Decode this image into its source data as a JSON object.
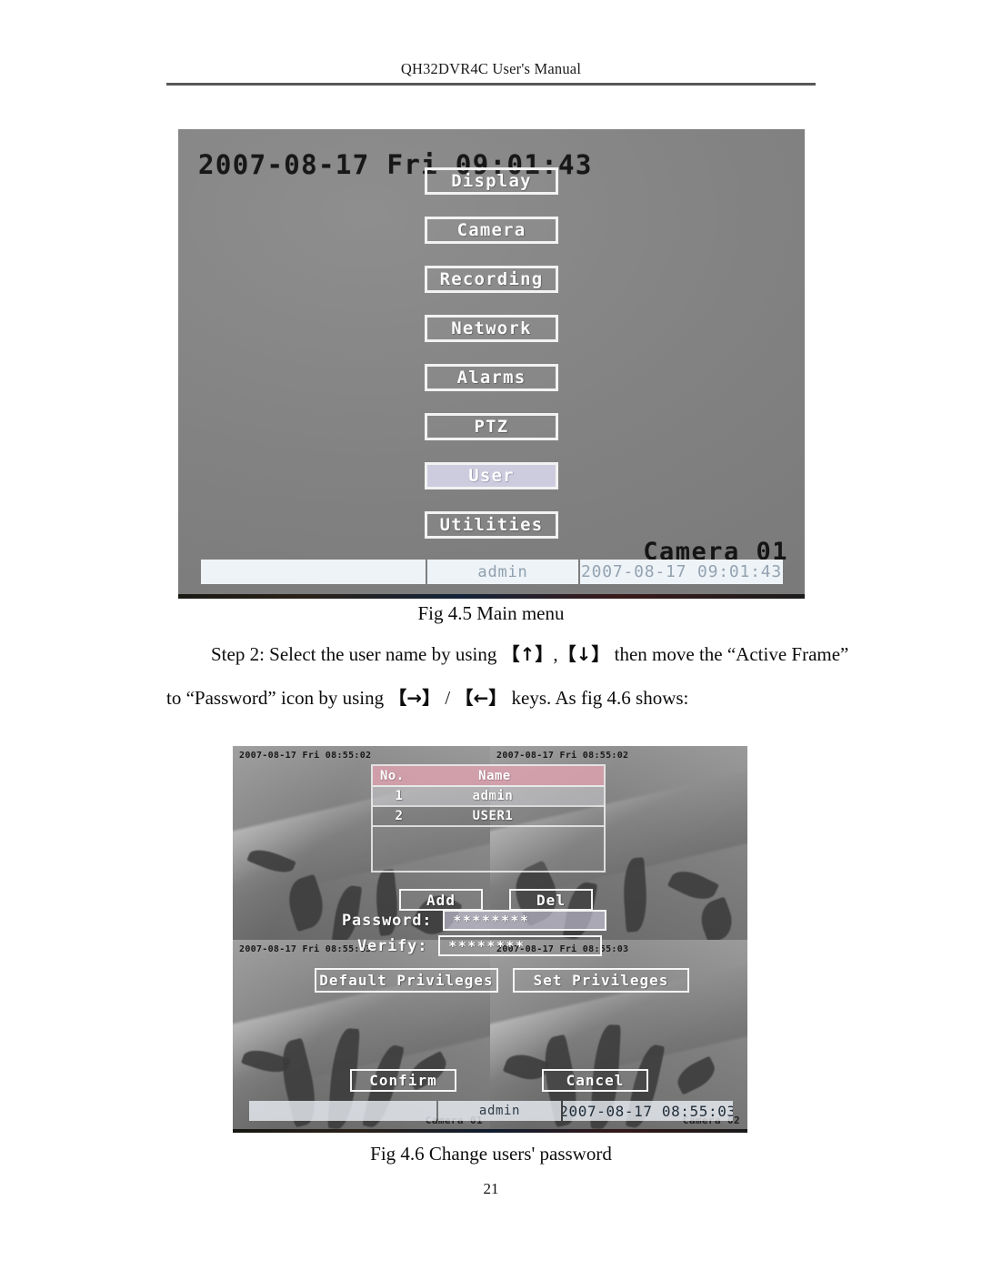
{
  "document": {
    "header_title": "QH32DVR4C User's Manual",
    "page_number": "21"
  },
  "figures": {
    "fig45": {
      "caption": "Fig 4.5 Main menu",
      "osd_datetime": "2007-08-17 Fri 09:01:43",
      "camera_label": "Camera 01",
      "menu_items": [
        {
          "label": "Display",
          "highlighted": false
        },
        {
          "label": "Camera",
          "highlighted": false
        },
        {
          "label": "Recording",
          "highlighted": false
        },
        {
          "label": "Network",
          "highlighted": false
        },
        {
          "label": "Alarms",
          "highlighted": false
        },
        {
          "label": "PTZ",
          "highlighted": false
        },
        {
          "label": "User",
          "highlighted": true
        },
        {
          "label": "Utilities",
          "highlighted": false
        }
      ],
      "statusbar": {
        "empty": "",
        "user": "admin",
        "datetime": "2007-08-17 09:01:43"
      },
      "highlight_color": "#cdccdf"
    },
    "fig46": {
      "caption": "Fig 4.6 Change users' password",
      "quadrants": [
        {
          "timestamp": "2007-08-17 Fri 08:55:02",
          "camera": ""
        },
        {
          "timestamp": "2007-08-17 Fri 08:55:02",
          "camera": ""
        },
        {
          "timestamp": "2007-08-17 Fri 08:55:03",
          "camera": "Camera 01"
        },
        {
          "timestamp": "2007-08-17 Fri 08:55:03",
          "camera": "Camera 02"
        }
      ],
      "user_table": {
        "headers": {
          "no": "No.",
          "name": "Name"
        },
        "rows": [
          {
            "no": "1",
            "name": "admin",
            "selected": true
          },
          {
            "no": "2",
            "name": "USER1",
            "selected": false
          }
        ]
      },
      "buttons": {
        "add": "Add",
        "del": "Del",
        "default_privileges": "Default Privileges",
        "set_privileges": "Set Privileges",
        "confirm": "Confirm",
        "cancel": "Cancel"
      },
      "fields": {
        "password_label": "Password:",
        "password_value": "********",
        "verify_label": "Verify:",
        "verify_value": "********"
      },
      "statusbar": {
        "empty": "",
        "user": "admin",
        "datetime": "2007-08-17 08:55:03"
      },
      "table_header_color": "#dea2b0"
    }
  },
  "body_text": {
    "line1_a": "Step 2: Select the user name by using",
    "line1_key1": "【↑】",
    "line1_sep": ",",
    "line1_key2": "【↓】",
    "line1_b": "then move the “Active Frame”",
    "line2_a": "to “Password” icon by using",
    "line2_key1": "【→】",
    "line2_sep": "/",
    "line2_key2": "【←】",
    "line2_b": "keys. As fig 4.6 shows:"
  }
}
